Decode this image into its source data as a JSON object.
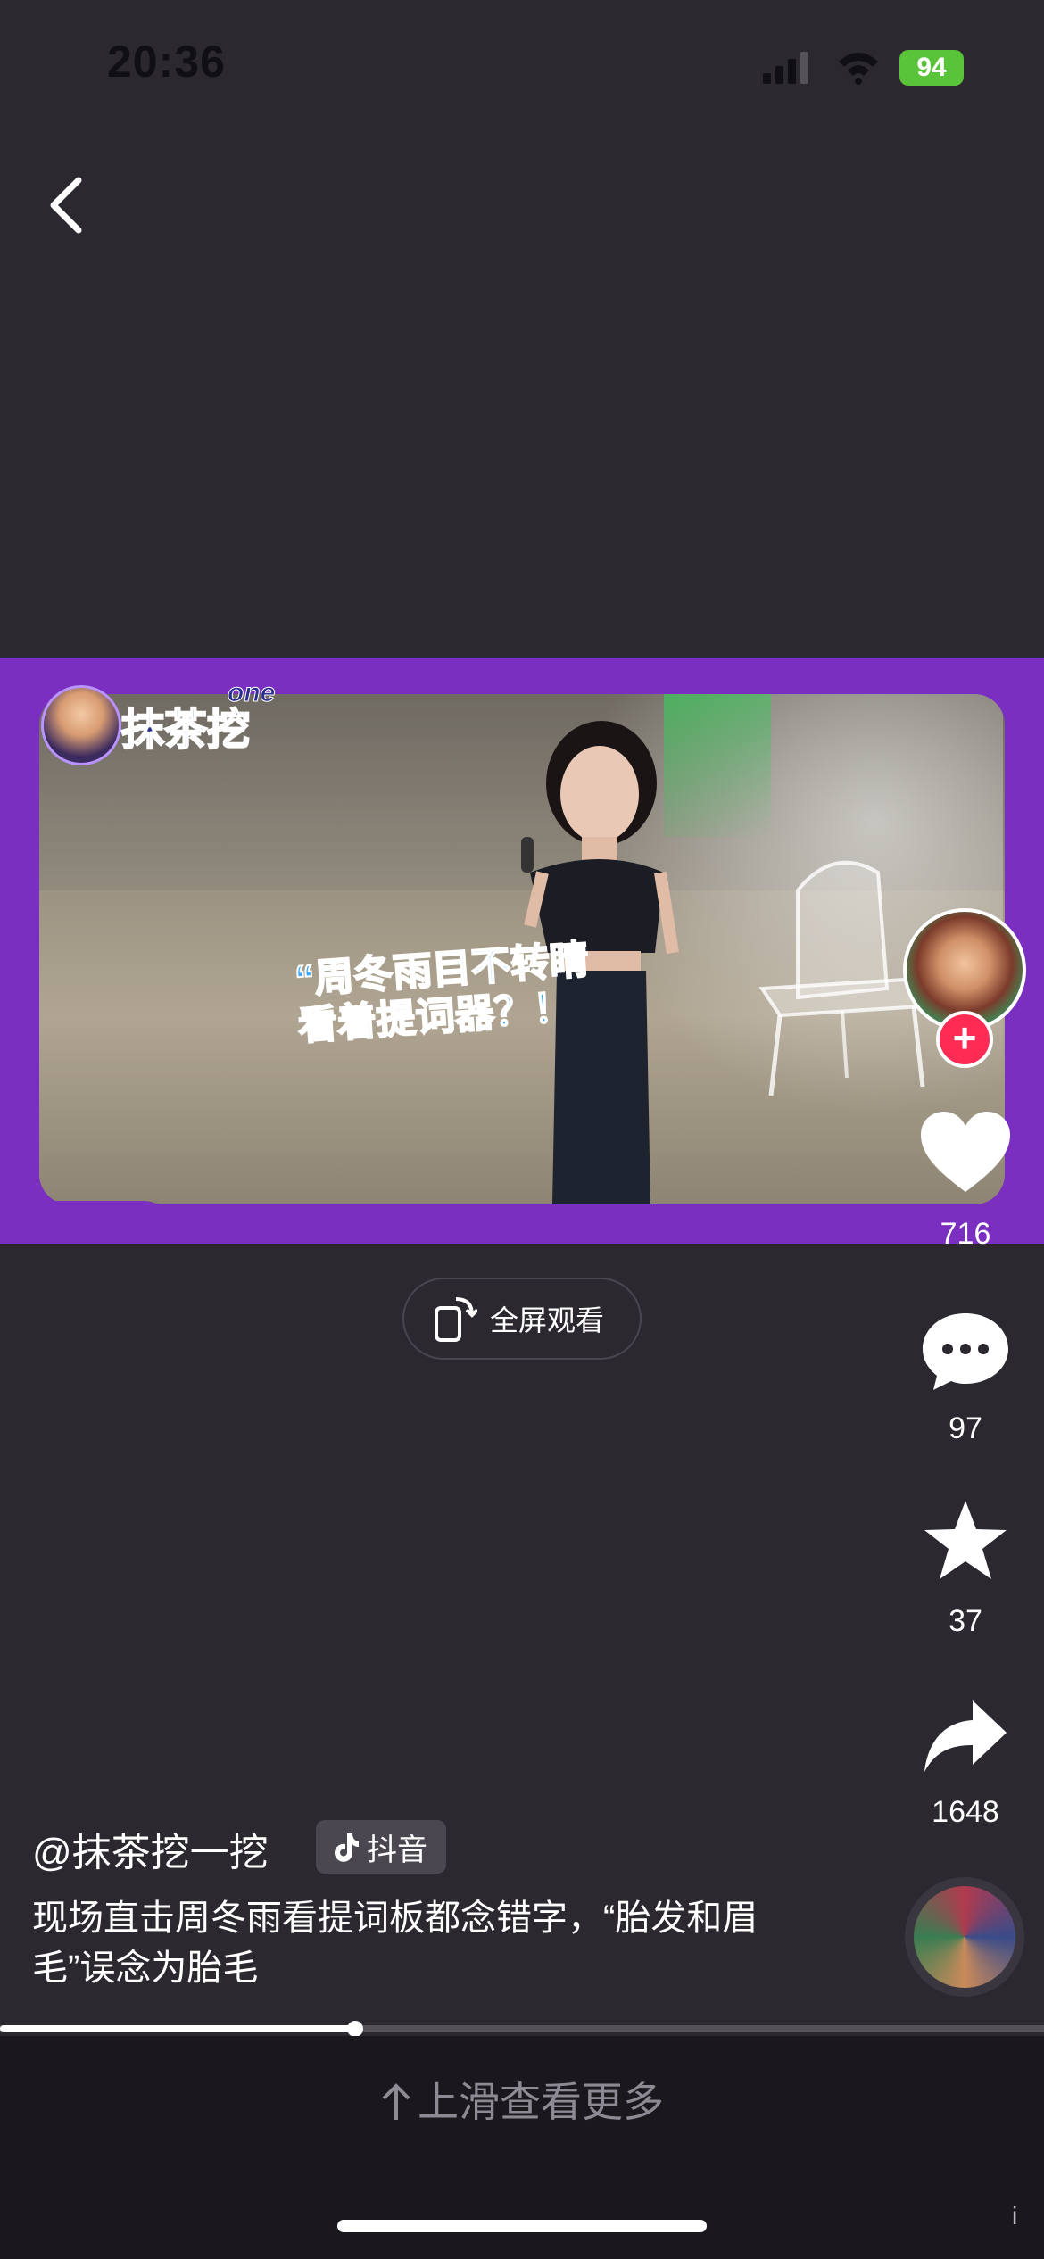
{
  "status_bar": {
    "time": "20:36",
    "battery": "94"
  },
  "video": {
    "channel_logo_text": "抹茶挖",
    "channel_logo_sub": "one",
    "caption_line1": "“周冬雨目不转睛",
    "caption_line2": "看着提词器？！"
  },
  "actions": {
    "likes": "716",
    "comments": "97",
    "favorites": "37",
    "shares": "1648",
    "follow": "+"
  },
  "fullscreen": {
    "label": "全屏观看"
  },
  "author": {
    "handle": "@抹茶挖一挖",
    "platform": "抖音"
  },
  "description": "现场直击周冬雨看提词板都念错字，“胎发和眉毛”误念为胎毛",
  "progress": {
    "fraction": 0.34
  },
  "bottom": {
    "swipe_hint": "上滑查看更多",
    "info": "i"
  },
  "colors": {
    "accent": "#fe2c55",
    "frame": "#7a2fc0",
    "background": "#2b282f",
    "battery": "#59c43a"
  }
}
